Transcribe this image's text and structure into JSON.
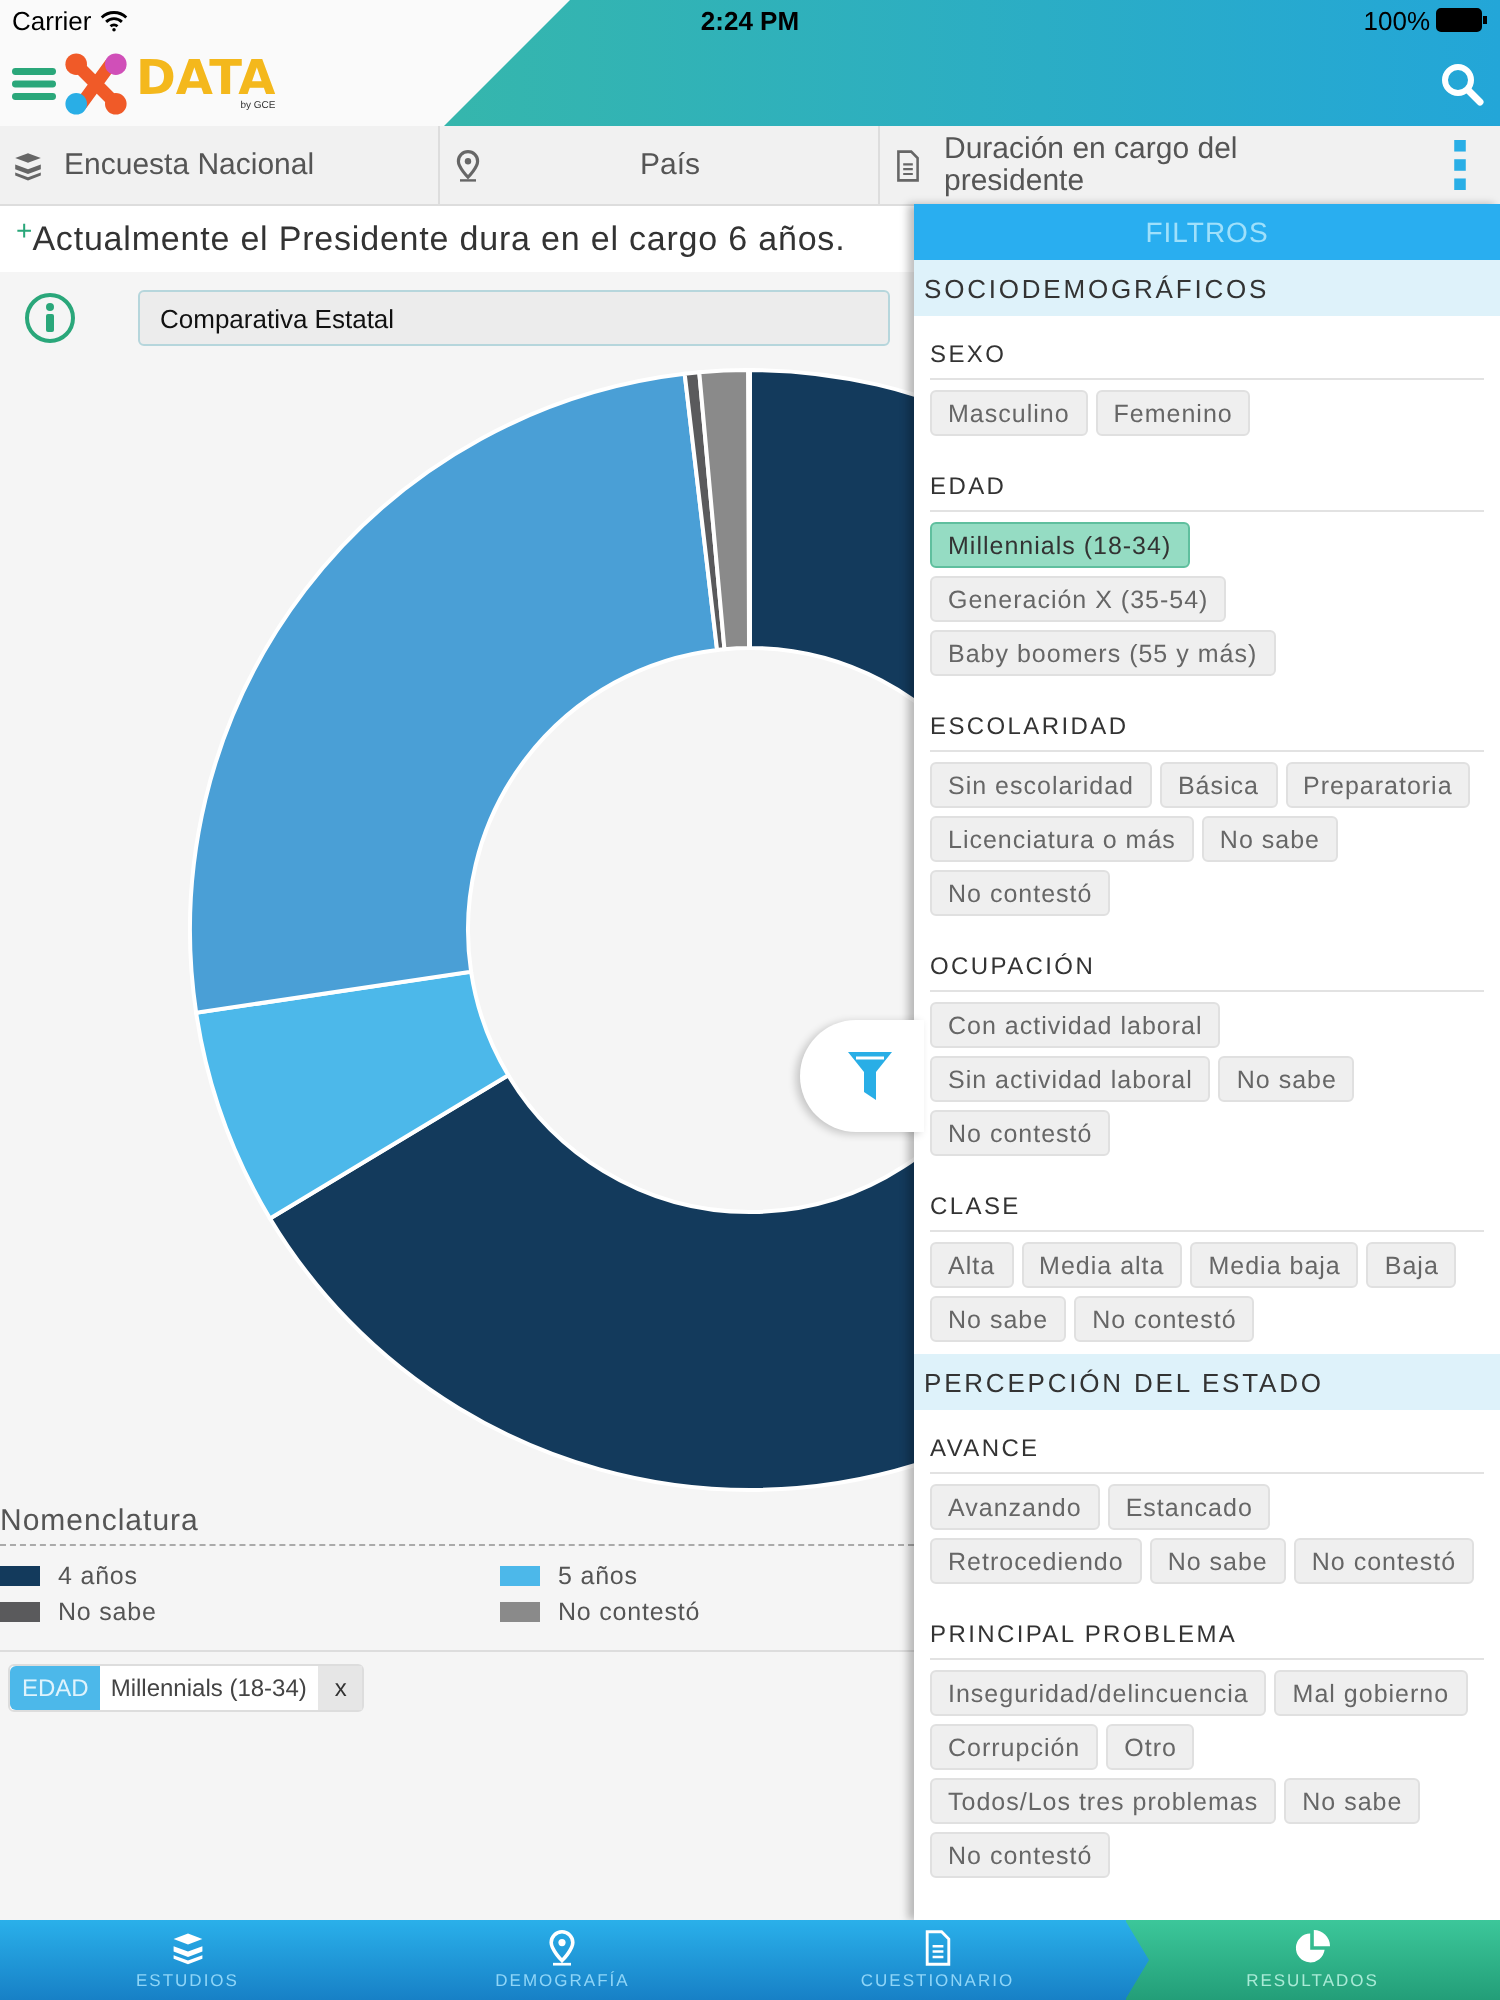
{
  "status_bar": {
    "carrier": "Carrier",
    "time": "2:24 PM",
    "battery": "100%"
  },
  "app": {
    "logo": "DATA",
    "logo_by": "by GCE"
  },
  "breadcrumbs": [
    {
      "label": "Encuesta Nacional",
      "kind": "study"
    },
    {
      "label": "País",
      "kind": "place"
    },
    {
      "label": "Duración en cargo del presidente",
      "kind": "question"
    }
  ],
  "question": {
    "marker": "+",
    "text": "Actualmente el Presidente dura en el cargo 6 años."
  },
  "comparison_select": {
    "value": "Comparativa Estatal"
  },
  "legend": {
    "title": "Nomenclatura",
    "items": [
      {
        "label": "4 años",
        "color": "#133a5c"
      },
      {
        "label": "5 años",
        "color": "#4cb8ea"
      },
      {
        "label": "No sabe",
        "color": "#5a5a5c"
      },
      {
        "label": "No contestó",
        "color": "#8a8a8a"
      }
    ]
  },
  "active_filters": [
    {
      "group": "EDAD",
      "value": "Millennials (18-34)",
      "remove": "x"
    }
  ],
  "filters_panel": {
    "title": "FILTROS",
    "sections": [
      {
        "title": "SOCIODEMOGRÁFICOS",
        "groups": [
          {
            "title": "SEXO",
            "options": [
              {
                "label": "Masculino",
                "selected": false
              },
              {
                "label": "Femenino",
                "selected": false
              }
            ]
          },
          {
            "title": "EDAD",
            "options": [
              {
                "label": "Millennials (18-34)",
                "selected": true
              },
              {
                "label": "Generación X (35-54)",
                "selected": false
              },
              {
                "label": "Baby boomers (55 y más)",
                "selected": false
              }
            ]
          },
          {
            "title": "ESCOLARIDAD",
            "options": [
              {
                "label": "Sin escolaridad",
                "selected": false
              },
              {
                "label": "Básica",
                "selected": false
              },
              {
                "label": "Preparatoria",
                "selected": false
              },
              {
                "label": "Licenciatura o más",
                "selected": false
              },
              {
                "label": "No sabe",
                "selected": false
              },
              {
                "label": "No contestó",
                "selected": false
              }
            ]
          },
          {
            "title": "OCUPACIÓN",
            "options": [
              {
                "label": "Con actividad laboral",
                "selected": false
              },
              {
                "label": "Sin actividad laboral",
                "selected": false
              },
              {
                "label": "No sabe",
                "selected": false
              },
              {
                "label": "No contestó",
                "selected": false
              }
            ]
          },
          {
            "title": "CLASE",
            "options": [
              {
                "label": "Alta",
                "selected": false
              },
              {
                "label": "Media alta",
                "selected": false
              },
              {
                "label": "Media baja",
                "selected": false
              },
              {
                "label": "Baja",
                "selected": false
              },
              {
                "label": "No sabe",
                "selected": false
              },
              {
                "label": "No contestó",
                "selected": false
              }
            ]
          }
        ]
      },
      {
        "title": "PERCEPCIÓN DEL ESTADO",
        "groups": [
          {
            "title": "AVANCE",
            "options": [
              {
                "label": "Avanzando",
                "selected": false
              },
              {
                "label": "Estancado",
                "selected": false
              },
              {
                "label": "Retrocediendo",
                "selected": false
              },
              {
                "label": "No sabe",
                "selected": false
              },
              {
                "label": "No contestó",
                "selected": false
              }
            ]
          },
          {
            "title": "PRINCIPAL PROBLEMA",
            "options": [
              {
                "label": "Inseguridad/delincuencia",
                "selected": false
              },
              {
                "label": "Mal gobierno",
                "selected": false
              },
              {
                "label": "Corrupción",
                "selected": false
              },
              {
                "label": "Otro",
                "selected": false
              },
              {
                "label": "Todos/Los tres problemas",
                "selected": false
              },
              {
                "label": "No sabe",
                "selected": false
              },
              {
                "label": "No contestó",
                "selected": false
              }
            ]
          }
        ]
      }
    ]
  },
  "nav": [
    {
      "label": "ESTUDIOS",
      "kind": "studies",
      "selected": false
    },
    {
      "label": "DEMOGRAFÍA",
      "kind": "place",
      "selected": false
    },
    {
      "label": "CUESTIONARIO",
      "kind": "question",
      "selected": false
    },
    {
      "label": "RESULTADOS",
      "kind": "results",
      "selected": true
    }
  ]
}
